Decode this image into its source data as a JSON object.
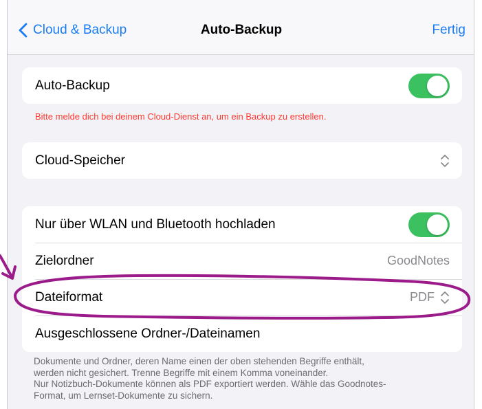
{
  "nav": {
    "back_label": "Cloud & Backup",
    "title": "Auto-Backup",
    "done_label": "Fertig"
  },
  "section1": {
    "auto_backup_label": "Auto-Backup",
    "auto_backup_on": true,
    "warning": "Bitte melde dich bei deinem Cloud-Dienst an, um ein Backup zu erstellen."
  },
  "section2": {
    "cloud_storage_label": "Cloud-Speicher"
  },
  "section3": {
    "wifi_label": "Nur über WLAN und Bluetooth hochladen",
    "wifi_on": true,
    "folder_label": "Zielordner",
    "folder_value": "GoodNotes",
    "format_label": "Dateiformat",
    "format_value": "PDF",
    "excluded_label": "Ausgeschlossene Ordner-/Dateinamen"
  },
  "footnote": {
    "line1": "Dokumente und Ordner, deren Name einen der oben stehenden Begriffe enthält,",
    "line2": "werden nicht gesichert. Trenne Begriffe mit einem Komma voneinander.",
    "line3": "Nur Notizbuch-Dokumente können als PDF exportiert werden. Wähle das Goodnotes-",
    "line4": "Format, um Lernset-Dokumente zu sichern."
  },
  "colors": {
    "accent": "#1a7cf0",
    "toggle_on": "#3bc160",
    "warning": "#ff3b30",
    "annotation": "#9b1b8a"
  },
  "icons": {
    "back": "chevron-left-icon",
    "picker": "chevron-up-down-icon"
  }
}
